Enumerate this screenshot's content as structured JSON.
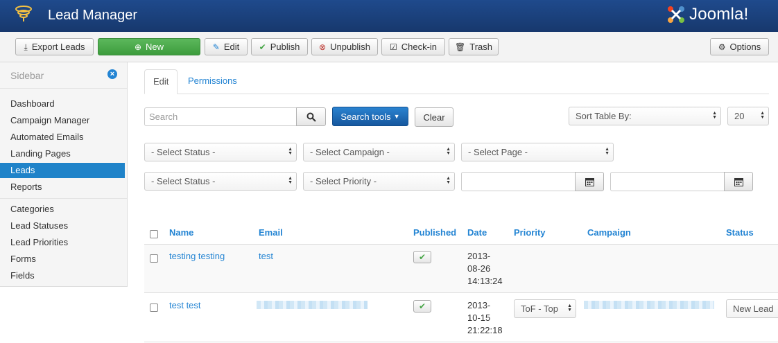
{
  "header": {
    "title": "Lead Manager",
    "brand": "Joomla!"
  },
  "toolbar": {
    "export": "Export Leads",
    "new": "New",
    "edit": "Edit",
    "publish": "Publish",
    "unpublish": "Unpublish",
    "checkin": "Check-in",
    "trash": "Trash",
    "options": "Options"
  },
  "sidebar": {
    "title": "Sidebar",
    "items": [
      "Dashboard",
      "Campaign Manager",
      "Automated Emails",
      "Landing Pages",
      "Leads",
      "Reports",
      "Categories",
      "Lead Statuses",
      "Lead Priorities",
      "Forms",
      "Fields"
    ],
    "active": "Leads"
  },
  "tabs": [
    "Edit",
    "Permissions"
  ],
  "search": {
    "placeholder": "Search",
    "tools": "Search tools",
    "clear": "Clear"
  },
  "sort": {
    "label": "Sort Table By:",
    "limit": "20"
  },
  "filters": {
    "status1": "- Select Status -",
    "campaign": "- Select Campaign -",
    "page": "- Select Page -",
    "status2": "- Select Status -",
    "priority": "- Select Priority -"
  },
  "table": {
    "headers": [
      "Name",
      "Email",
      "Published",
      "Date",
      "Priority",
      "Campaign",
      "Status"
    ],
    "rows": [
      {
        "name": "testing testing",
        "email": "test",
        "date1": "2013-",
        "date2": "08-26",
        "date3": "14:13:24",
        "priority": "",
        "status": ""
      },
      {
        "name": "test test",
        "email": "",
        "date1": "2013-",
        "date2": "10-15",
        "date3": "21:22:18",
        "priority": "ToF - Top",
        "status": "New Lead"
      }
    ]
  },
  "colors": {
    "header": "#1f4a8c",
    "accent": "#2384d3",
    "green": "#46a546",
    "active_sidebar": "#1f83c9"
  }
}
